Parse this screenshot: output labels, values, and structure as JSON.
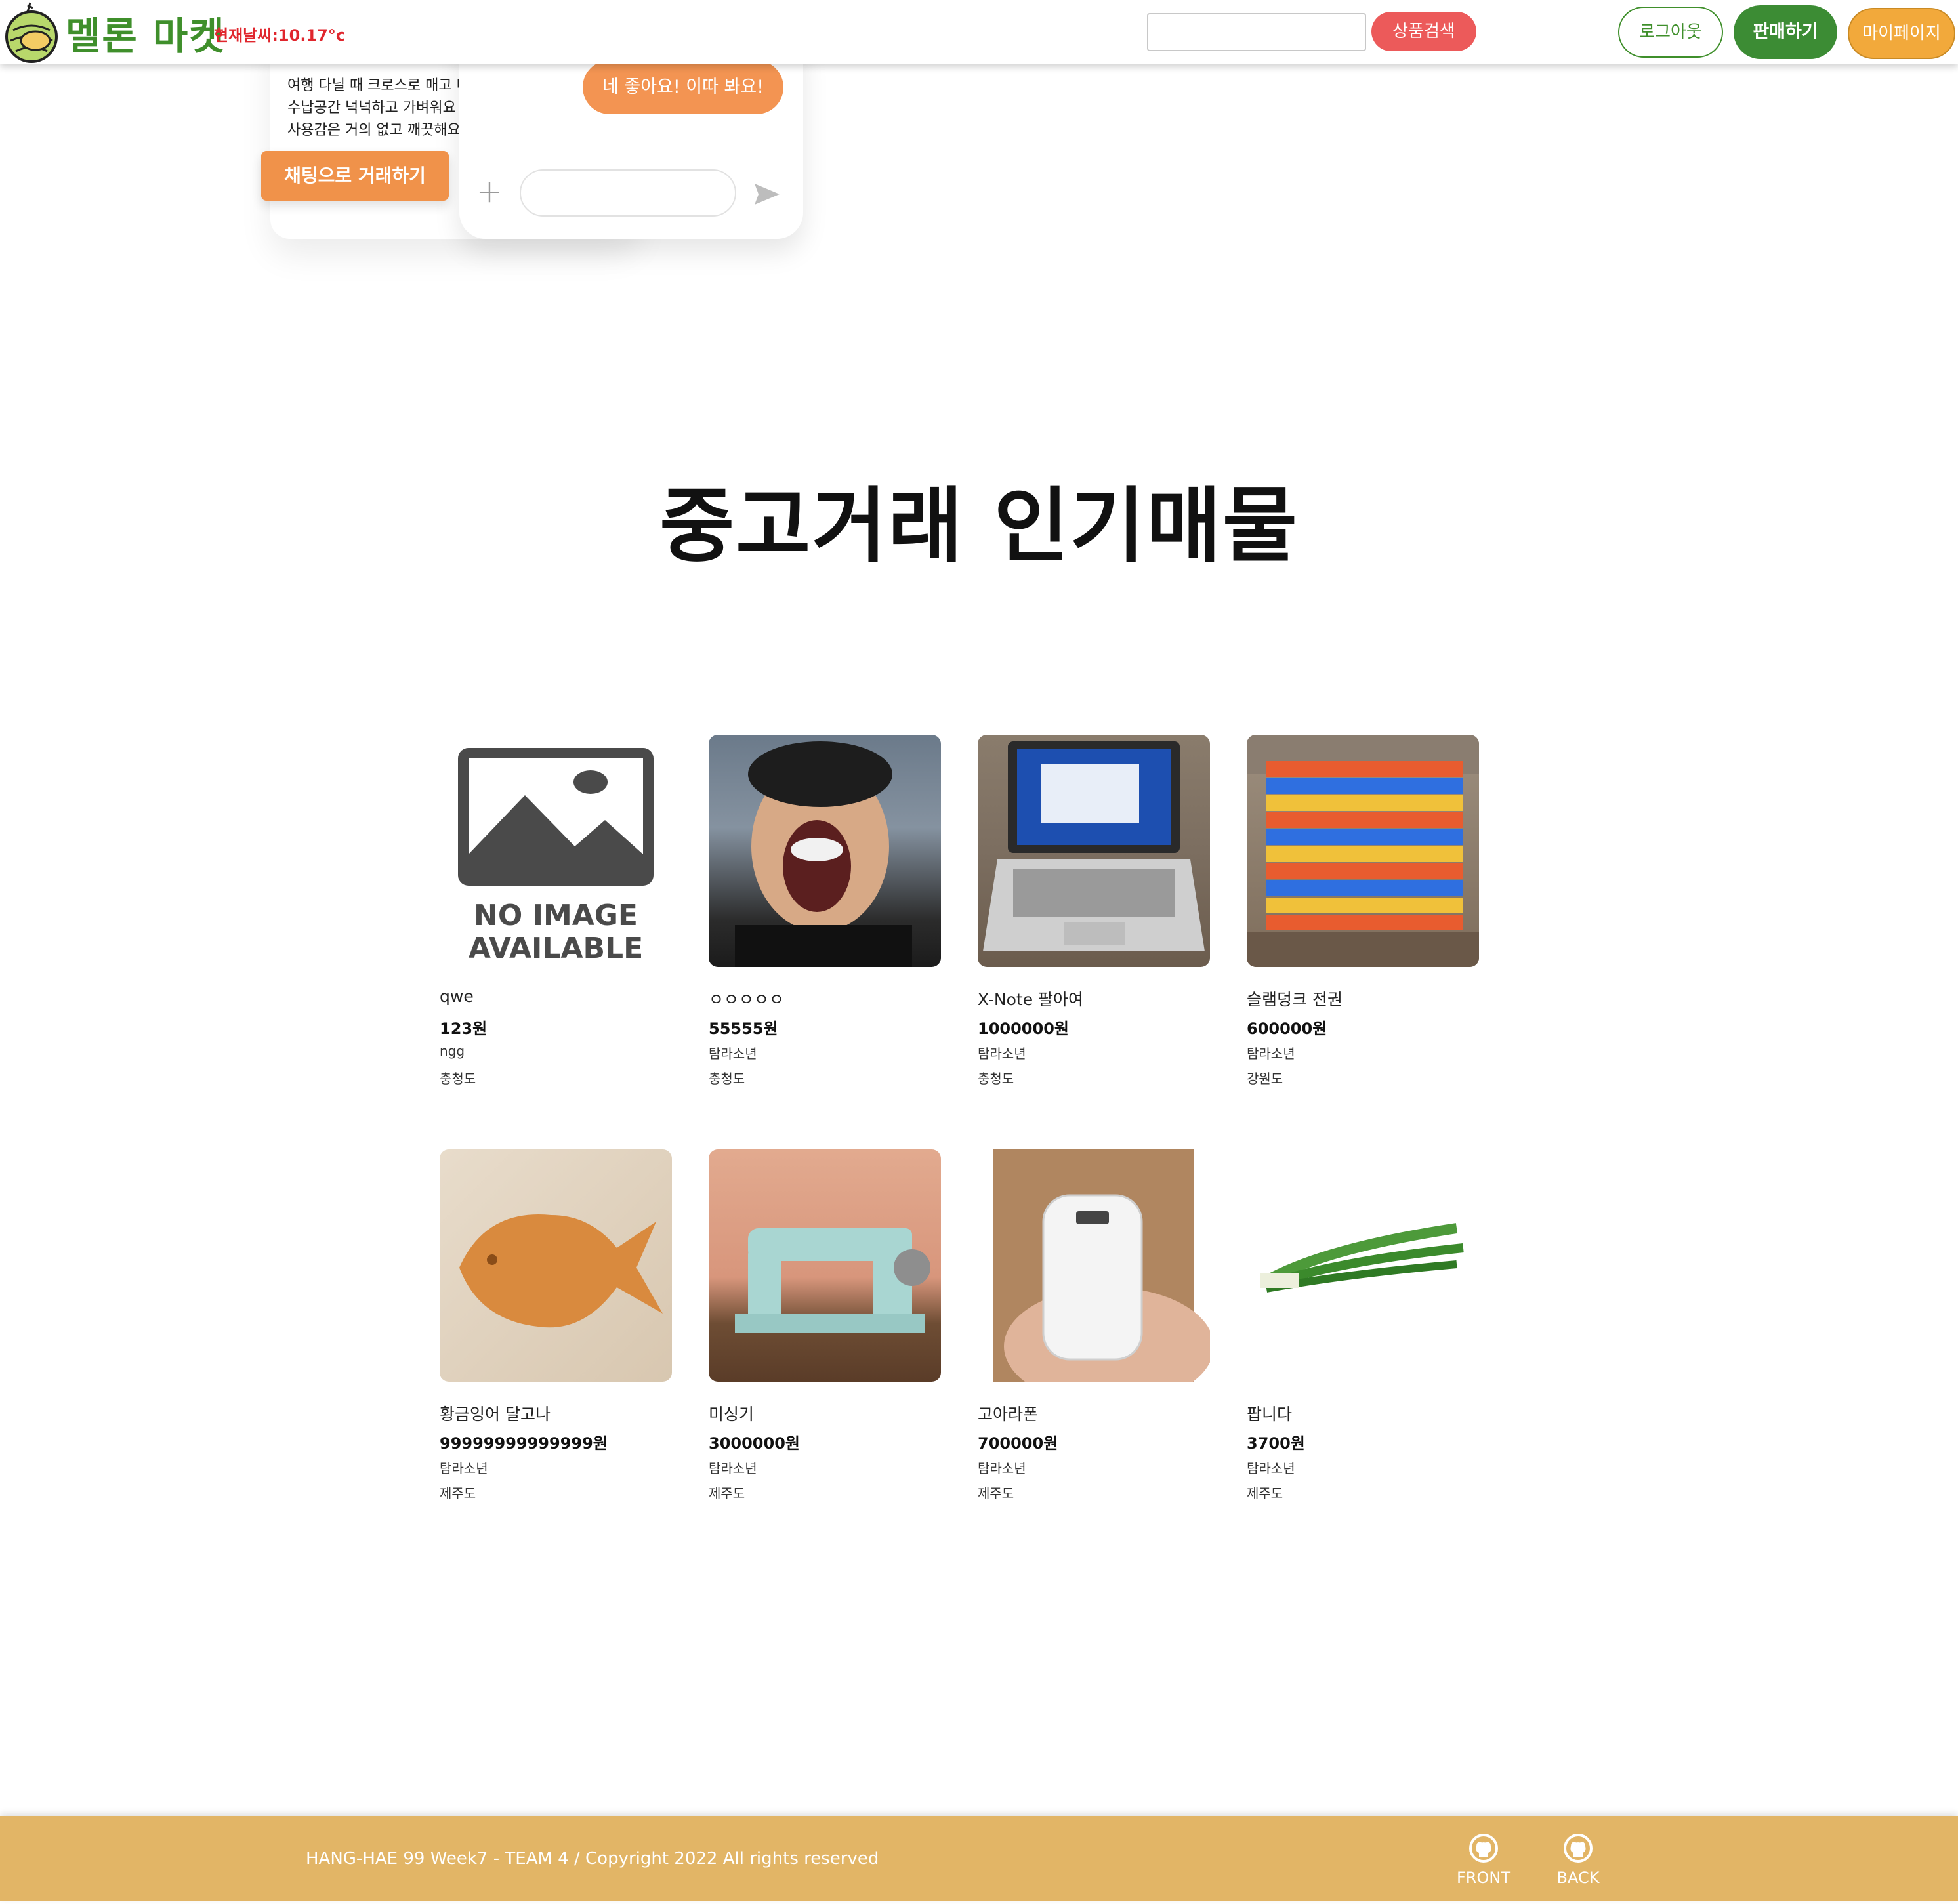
{
  "header": {
    "logo_text": "멜론 마켓",
    "weather": "현재날씨:10.17°c",
    "search_placeholder": "",
    "search_button": "상품검색",
    "logout_button": "로그아웃",
    "sell_button": "판매하기",
    "mypage_button": "마이페이지"
  },
  "hero": {
    "lines": [
      "여행 다닐 때 크로스로 매고 다",
      "수납공간 넉넉하고 가벼워요",
      "사용감은 거의 없고 깨끗해요"
    ],
    "trade_button": "채팅으로 거래하기",
    "chat_bubble": "네 좋아요! 이따 봐요!",
    "chat_plus": "+"
  },
  "section": {
    "title": "중고거래 인기매물"
  },
  "products": [
    {
      "name": "qwe",
      "price": "123원",
      "seller": "ngg",
      "region": "충청도",
      "image": "no-image",
      "image_text_1": "NO IMAGE",
      "image_text_2": "AVAILABLE"
    },
    {
      "name": "ㅇㅇㅇㅇㅇ",
      "price": "55555원",
      "seller": "탐라소년",
      "region": "충청도",
      "image": "shouting-man-photo"
    },
    {
      "name": "X-Note 팔아여",
      "price": "1000000원",
      "seller": "탐라소년",
      "region": "충청도",
      "image": "laptop-photo"
    },
    {
      "name": "슬램덩크 전권",
      "price": "600000원",
      "seller": "탐라소년",
      "region": "강원도",
      "image": "comic-books-photo"
    },
    {
      "name": "황금잉어 달고나",
      "price": "99999999999999원",
      "seller": "탐라소년",
      "region": "제주도",
      "image": "fish-candy-photo"
    },
    {
      "name": "미싱기",
      "price": "3000000원",
      "seller": "탐라소년",
      "region": "제주도",
      "image": "sewing-machine-photo"
    },
    {
      "name": "고아라폰",
      "price": "700000원",
      "seller": "탐라소년",
      "region": "제주도",
      "image": "flip-phone-photo"
    },
    {
      "name": "팝니다",
      "price": "3700원",
      "seller": "탐라소년",
      "region": "제주도",
      "image": "green-onion-photo"
    }
  ],
  "footer": {
    "copyright": "HANG-HAE 99 Week7 - TEAM 4 / Copyright 2022 All rights reserved",
    "front_label": "FRONT",
    "back_label": "BACK"
  },
  "colors": {
    "brand_green": "#3f8f2b",
    "search_red": "#ec5a5a",
    "mypage_orange": "#f2a93b",
    "chat_orange": "#f39452",
    "footer_gold": "#e2b566"
  }
}
